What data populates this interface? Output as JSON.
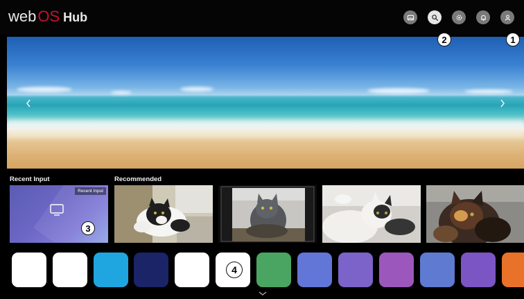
{
  "header": {
    "brand": {
      "web": "web",
      "os": "OS",
      "hub": "Hub"
    },
    "icons": [
      {
        "name": "image-icon",
        "active": false
      },
      {
        "name": "search-icon",
        "active": true
      },
      {
        "name": "settings-icon",
        "active": false
      },
      {
        "name": "notification-icon",
        "active": false
      },
      {
        "name": "account-icon",
        "active": false
      }
    ]
  },
  "callouts": {
    "one": "1",
    "two": "2",
    "three": "3",
    "four": "4"
  },
  "hero": {
    "prev_icon": "chevron-left-icon",
    "next_icon": "chevron-right-icon"
  },
  "sections": {
    "recent_input": {
      "title": "Recent Input",
      "tag": "Recent Input",
      "icon": "tv-icon"
    },
    "recommended": {
      "title": "Recommended",
      "items": [
        "cat-1",
        "cat-2",
        "cat-3",
        "cat-4"
      ]
    }
  },
  "apps": {
    "tiles": [
      {
        "color": "#ffffff"
      },
      {
        "color": "#ffffff"
      },
      {
        "color": "#1fa6e0"
      },
      {
        "color": "#1a2467"
      },
      {
        "color": "#ffffff"
      },
      {
        "color": "#ffffff"
      },
      {
        "color": "#4aa562"
      },
      {
        "color": "#6176d6"
      },
      {
        "color": "#7c63c9"
      },
      {
        "color": "#9c57bd"
      },
      {
        "color": "#5f7bd1"
      },
      {
        "color": "#7b55c3"
      },
      {
        "color": "#e8722a"
      }
    ]
  },
  "colors": {
    "brand_red": "#c8102e",
    "header_icon": "#7a7a7a",
    "header_icon_active": "#e6e6e6"
  }
}
